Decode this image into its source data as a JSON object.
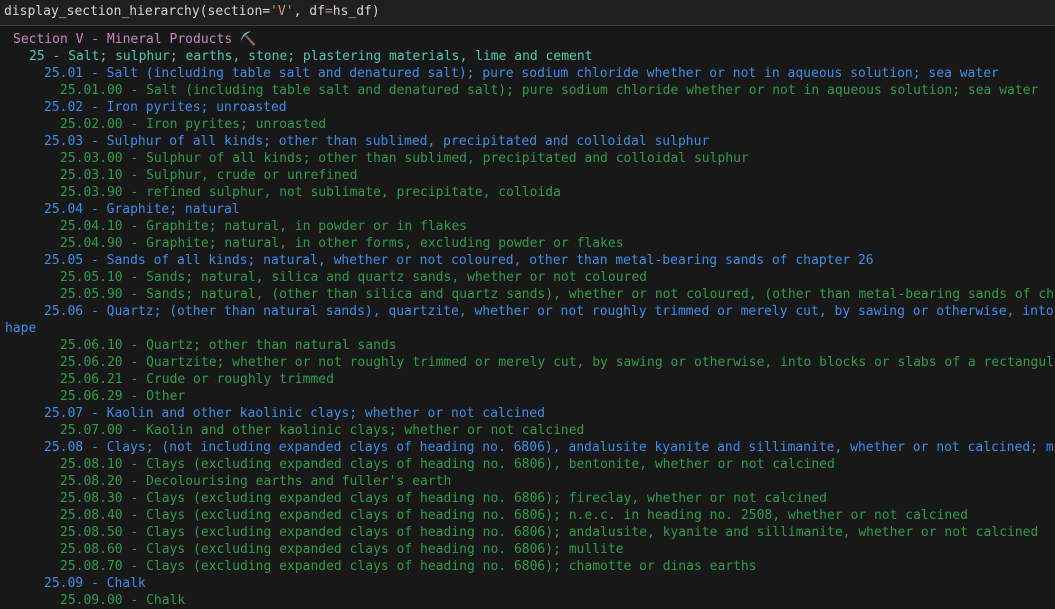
{
  "input": {
    "code_fn": "display_section_hierarchy(section=",
    "code_str": "'V'",
    "code_mid": ", df",
    "code_eq": "=",
    "code_end": "hs_df)"
  },
  "output": {
    "lines": [
      {
        "level": "section",
        "text": "Section V - Mineral Products ⛏️"
      },
      {
        "level": "chapter",
        "text": "25 - Salt; sulphur; earths, stone; plastering materials, lime and cement"
      },
      {
        "level": "heading",
        "text": "25.01 - Salt (including table salt and denatured salt); pure sodium chloride whether or not in aqueous solution; sea water"
      },
      {
        "level": "sub",
        "text": "25.01.00 - Salt (including table salt and denatured salt); pure sodium chloride whether or not in aqueous solution; sea water"
      },
      {
        "level": "heading",
        "text": "25.02 - Iron pyrites; unroasted"
      },
      {
        "level": "sub",
        "text": "25.02.00 - Iron pyrites; unroasted"
      },
      {
        "level": "heading",
        "text": "25.03 - Sulphur of all kinds; other than sublimed, precipitated and colloidal sulphur"
      },
      {
        "level": "sub",
        "text": "25.03.00 - Sulphur of all kinds; other than sublimed, precipitated and colloidal sulphur"
      },
      {
        "level": "sub",
        "text": "25.03.10 - Sulphur, crude or unrefined"
      },
      {
        "level": "sub",
        "text": "25.03.90 - refined sulphur, not sublimate, precipitate, colloida"
      },
      {
        "level": "heading",
        "text": "25.04 - Graphite; natural"
      },
      {
        "level": "sub",
        "text": "25.04.10 - Graphite; natural, in powder or in flakes"
      },
      {
        "level": "sub",
        "text": "25.04.90 - Graphite; natural, in other forms, excluding powder or flakes"
      },
      {
        "level": "heading",
        "text": "25.05 - Sands of all kinds; natural, whether or not coloured, other than metal-bearing sands of chapter 26"
      },
      {
        "level": "sub",
        "text": "25.05.10 - Sands; natural, silica and quartz sands, whether or not coloured"
      },
      {
        "level": "sub",
        "text": "25.05.90 - Sands; natural, (other than silica and quartz sands), whether or not coloured, (other than metal-bearing sands of ch"
      },
      {
        "level": "heading",
        "text": "25.06 - Quartz; (other than natural sands), quartzite, whether or not roughly trimmed or merely cut, by sawing or otherwise, into"
      },
      {
        "level": "wrap",
        "text": "hape"
      },
      {
        "level": "sub",
        "text": "25.06.10 - Quartz; other than natural sands"
      },
      {
        "level": "sub",
        "text": "25.06.20 - Quartzite; whether or not roughly trimmed or merely cut, by sawing or otherwise, into blocks or slabs of a rectangul"
      },
      {
        "level": "sub",
        "text": "25.06.21 - Crude or roughly trimmed"
      },
      {
        "level": "sub",
        "text": "25.06.29 - Other"
      },
      {
        "level": "heading",
        "text": "25.07 - Kaolin and other kaolinic clays; whether or not calcined"
      },
      {
        "level": "sub",
        "text": "25.07.00 - Kaolin and other kaolinic clays; whether or not calcined"
      },
      {
        "level": "heading",
        "text": "25.08 - Clays; (not including expanded clays of heading no. 6806), andalusite kyanite and sillimanite, whether or not calcined; m"
      },
      {
        "level": "sub",
        "text": "25.08.10 - Clays (excluding expanded clays of heading no. 6806), bentonite, whether or not calcined"
      },
      {
        "level": "sub",
        "text": "25.08.20 - Decolourising earths and fuller's earth"
      },
      {
        "level": "sub",
        "text": "25.08.30 - Clays (excluding expanded clays of heading no. 6806); fireclay, whether or not calcined"
      },
      {
        "level": "sub",
        "text": "25.08.40 - Clays (excluding expanded clays of heading no. 6806); n.e.c. in heading no. 2508, whether or not calcined"
      },
      {
        "level": "sub",
        "text": "25.08.50 - Clays (excluding expanded clays of heading no. 6806); andalusite, kyanite and sillimanite, whether or not calcined"
      },
      {
        "level": "sub",
        "text": "25.08.60 - Clays (excluding expanded clays of heading no. 6806); mullite"
      },
      {
        "level": "sub",
        "text": "25.08.70 - Clays (excluding expanded clays of heading no. 6806); chamotte or dinas earths"
      },
      {
        "level": "heading",
        "text": "25.09 - Chalk"
      },
      {
        "level": "sub",
        "text": "25.09.00 - Chalk"
      }
    ]
  }
}
